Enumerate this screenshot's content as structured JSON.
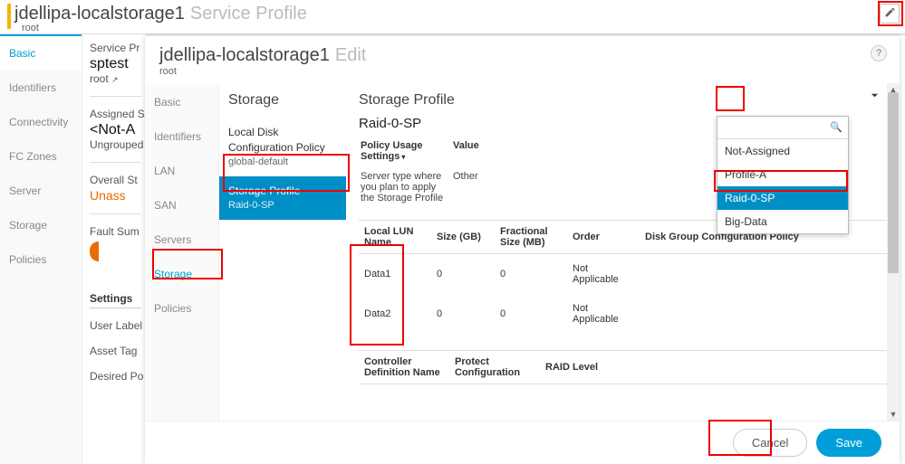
{
  "header": {
    "title": "jdellipa-localstorage1",
    "section": "Service Profile",
    "root": "root"
  },
  "edit_icon_title": "Edit",
  "leftnav": {
    "items": [
      "Basic",
      "Identifiers",
      "Connectivity",
      "FC Zones",
      "Server",
      "Storage",
      "Policies"
    ],
    "active": 0
  },
  "midpanel": {
    "svc_label": "Service Pr",
    "sp_name": "sptest",
    "sp_root": "root",
    "link_glyph": "↗",
    "assigned_label": "Assigned S",
    "assigned_val": "<Not-A",
    "assigned_sub": "Ungrouped",
    "overall_label": "Overall St",
    "overall_val": "Unass",
    "fault_label": "Fault Sum",
    "settings_heading": "Settings",
    "rows": [
      "User Label",
      "Asset Tag",
      "Desired Po"
    ]
  },
  "dialog": {
    "title": "jdellipa-localstorage1",
    "mode": "Edit",
    "root": "root",
    "help": "?",
    "innernav": {
      "items": [
        "Basic",
        "Identifiers",
        "LAN",
        "SAN",
        "Servers",
        "Storage",
        "Policies"
      ],
      "active": 5
    },
    "storage_col": {
      "heading": "Storage",
      "items": [
        {
          "title": "Local Disk Configuration Policy",
          "sub": "global-default"
        },
        {
          "title": "Storage Profile",
          "sub": "Raid-0-SP"
        }
      ],
      "selected": 1
    },
    "profile": {
      "heading": "Storage Profile",
      "name": "Raid-0-SP",
      "settings_col": "Policy Usage Settings",
      "value_col": "Value",
      "server_type_label": "Server type where you plan to apply the Storage Profile",
      "server_type_value": "Other",
      "lun_headers": [
        "Local LUN Name",
        "Size (GB)",
        "Fractional Size (MB)",
        "Order",
        "Disk Group Configuration Policy"
      ],
      "luns": [
        {
          "name": "Data1",
          "size": "0",
          "frac": "0",
          "order": "Not Applicable",
          "dg": ""
        },
        {
          "name": "Data2",
          "size": "0",
          "frac": "0",
          "order": "Not Applicable",
          "dg": ""
        }
      ],
      "ctrl_headers": [
        "Controller Definition Name",
        "Protect Configuration",
        "RAID Level"
      ]
    },
    "dropdown": {
      "search_placeholder": "",
      "options": [
        "Not-Assigned",
        "Profile-A",
        "Raid-0-SP",
        "Big-Data"
      ],
      "selected": 2
    },
    "footer": {
      "cancel": "Cancel",
      "save": "Save"
    }
  }
}
